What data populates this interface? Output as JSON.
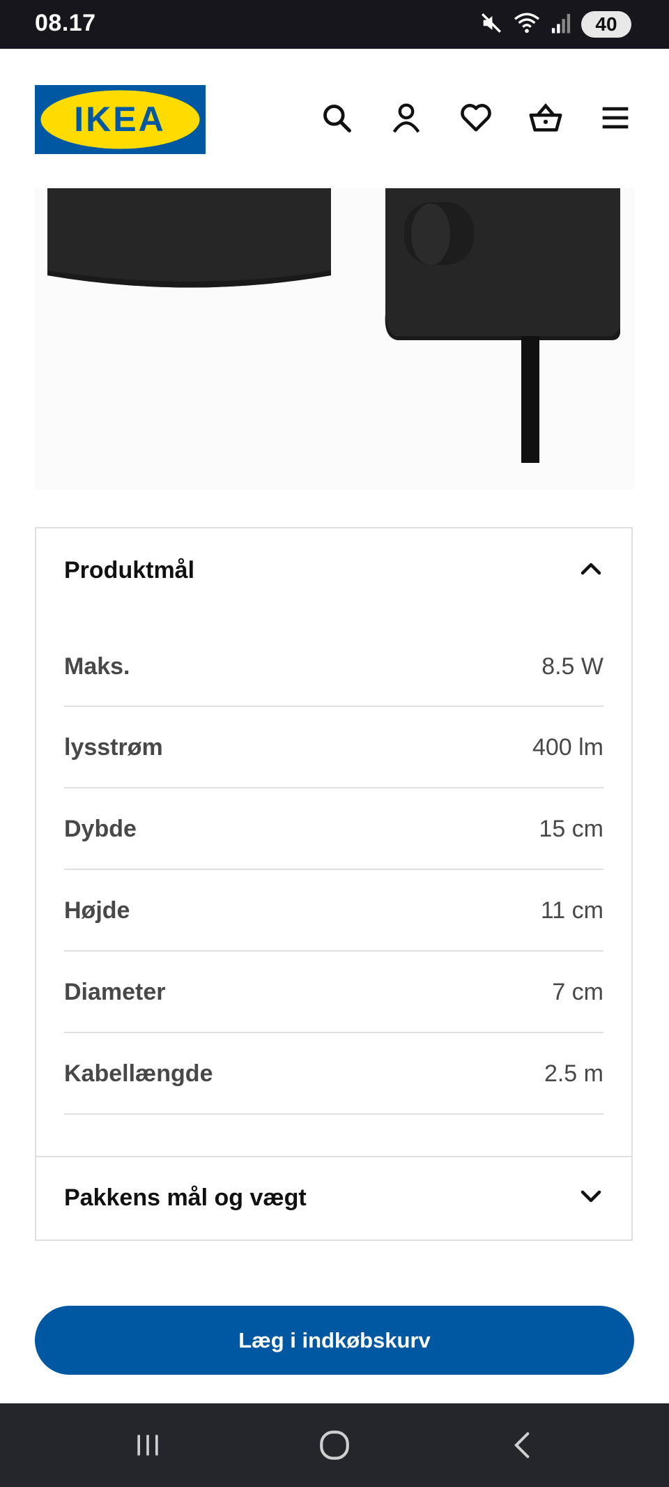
{
  "status_bar": {
    "time": "08.17",
    "battery": "40",
    "icons": [
      "mute-icon",
      "wifi-icon",
      "signal-icon"
    ]
  },
  "header": {
    "logo_text": "IKEA",
    "icons": [
      "search-icon",
      "account-icon",
      "heart-icon",
      "basket-icon",
      "menu-icon"
    ]
  },
  "colors": {
    "brand_blue": "#0058a3",
    "brand_yellow": "#ffdb00"
  },
  "product_dimensions": {
    "title": "Produktmål",
    "expanded": true,
    "rows": [
      {
        "label": "Maks.",
        "value": "8.5 W"
      },
      {
        "label": "lysstrøm",
        "value": "400 lm"
      },
      {
        "label": "Dybde",
        "value": "15 cm"
      },
      {
        "label": "Højde",
        "value": "11 cm"
      },
      {
        "label": "Diameter",
        "value": "7 cm"
      },
      {
        "label": "Kabellængde",
        "value": "2.5 m"
      }
    ]
  },
  "package": {
    "title": "Pakkens mål og vægt",
    "expanded": false
  },
  "cta": {
    "label": "Læg i indkøbskurv"
  },
  "system_nav": [
    "recents-icon",
    "home-icon",
    "back-icon"
  ]
}
